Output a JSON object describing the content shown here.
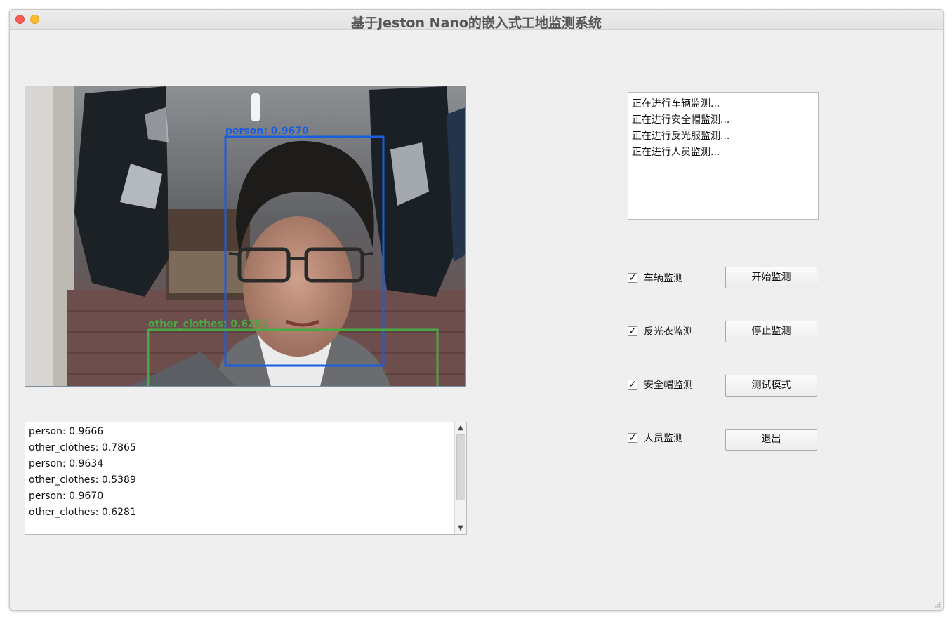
{
  "window": {
    "title": "基于Jeston Nano的嵌入式工地监测系统"
  },
  "camera": {
    "detections": [
      {
        "label": "person:  0.9670",
        "color": "#1a5de0"
      },
      {
        "label": "other_clothes: 0.6281",
        "color": "#4aa845"
      }
    ]
  },
  "detection_log": {
    "lines": [
      "person: 0.9666",
      "other_clothes: 0.7865",
      "person: 0.9634",
      "other_clothes: 0.5389",
      "person: 0.9670",
      "other_clothes: 0.6281"
    ]
  },
  "status_log": {
    "lines": [
      "正在进行车辆监测...",
      "正在进行安全帽监测...",
      "正在进行反光服监测...",
      "正在进行人员监测..."
    ]
  },
  "options": [
    {
      "label": "车辆监测",
      "checked": true
    },
    {
      "label": "反光衣监测",
      "checked": true
    },
    {
      "label": "安全帽监测",
      "checked": true
    },
    {
      "label": "人员监测",
      "checked": true
    }
  ],
  "buttons": {
    "start": "开始监测",
    "stop": "停止监测",
    "test": "测试模式",
    "exit": "退出"
  },
  "check_mark": "✓"
}
